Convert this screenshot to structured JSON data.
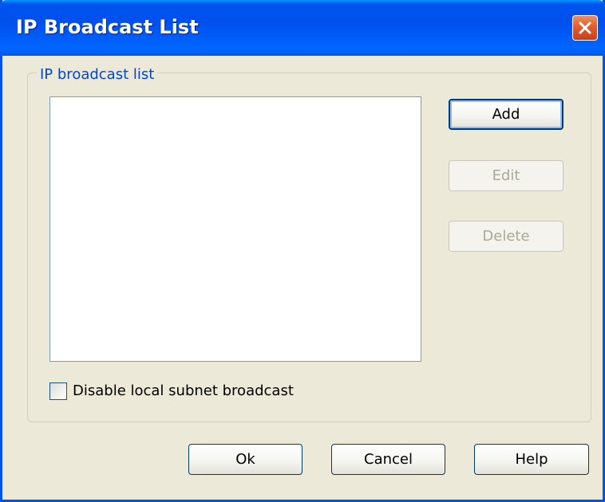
{
  "window": {
    "title": "IP Broadcast List"
  },
  "group": {
    "label": "IP broadcast list",
    "items": []
  },
  "side_buttons": {
    "add": "Add",
    "edit": "Edit",
    "delete": "Delete"
  },
  "options": {
    "disable_local_subnet_broadcast": {
      "label": "Disable local subnet broadcast",
      "checked": false
    }
  },
  "footer_buttons": {
    "ok": "Ok",
    "cancel": "Cancel",
    "help": "Help"
  },
  "colors": {
    "title_bar": "#0054e3",
    "dialog_background": "#ece9d8",
    "group_label": "#0046d5",
    "close_button": "#e45c2f",
    "disabled_text": "#aca899"
  },
  "icons": {
    "close": "close-icon"
  }
}
